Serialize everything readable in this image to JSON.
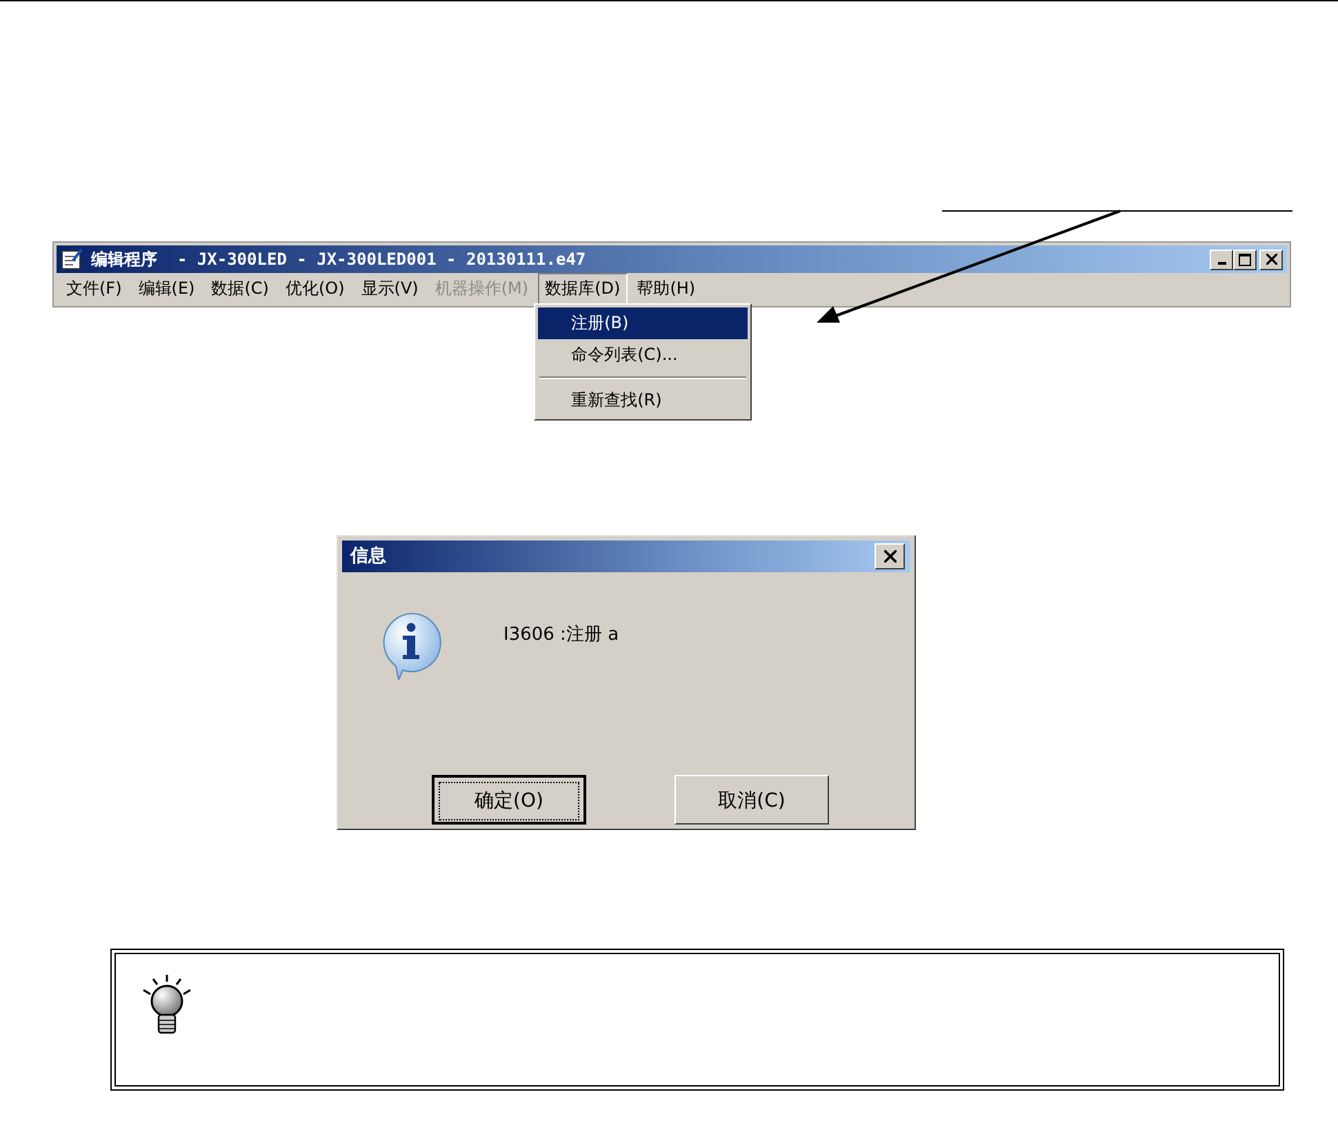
{
  "main_window": {
    "title": "编辑程序  - JX-300LED - JX-300LED001 - 20130111.e47",
    "menu": [
      {
        "label": "文件(F)",
        "disabled": false,
        "open": false
      },
      {
        "label": "编辑(E)",
        "disabled": false,
        "open": false
      },
      {
        "label": "数据(C)",
        "disabled": false,
        "open": false
      },
      {
        "label": "优化(O)",
        "disabled": false,
        "open": false
      },
      {
        "label": "显示(V)",
        "disabled": false,
        "open": false
      },
      {
        "label": "机器操作(M)",
        "disabled": true,
        "open": false
      },
      {
        "label": "数据库(D)",
        "disabled": false,
        "open": true
      },
      {
        "label": "帮助(H)",
        "disabled": false,
        "open": false
      }
    ]
  },
  "dropdown": {
    "items": [
      {
        "kind": "item",
        "label": "注册(B)",
        "selected": true
      },
      {
        "kind": "item",
        "label": "命令列表(C)...",
        "selected": false
      },
      {
        "kind": "separator"
      },
      {
        "kind": "item",
        "label": "重新查找(R)",
        "selected": false
      }
    ]
  },
  "dialog": {
    "title": "信息",
    "message": "I3606 :注册 a",
    "buttons": [
      {
        "label": "确定(O)",
        "default": true
      },
      {
        "label": "取消(C)",
        "default": false
      }
    ]
  }
}
